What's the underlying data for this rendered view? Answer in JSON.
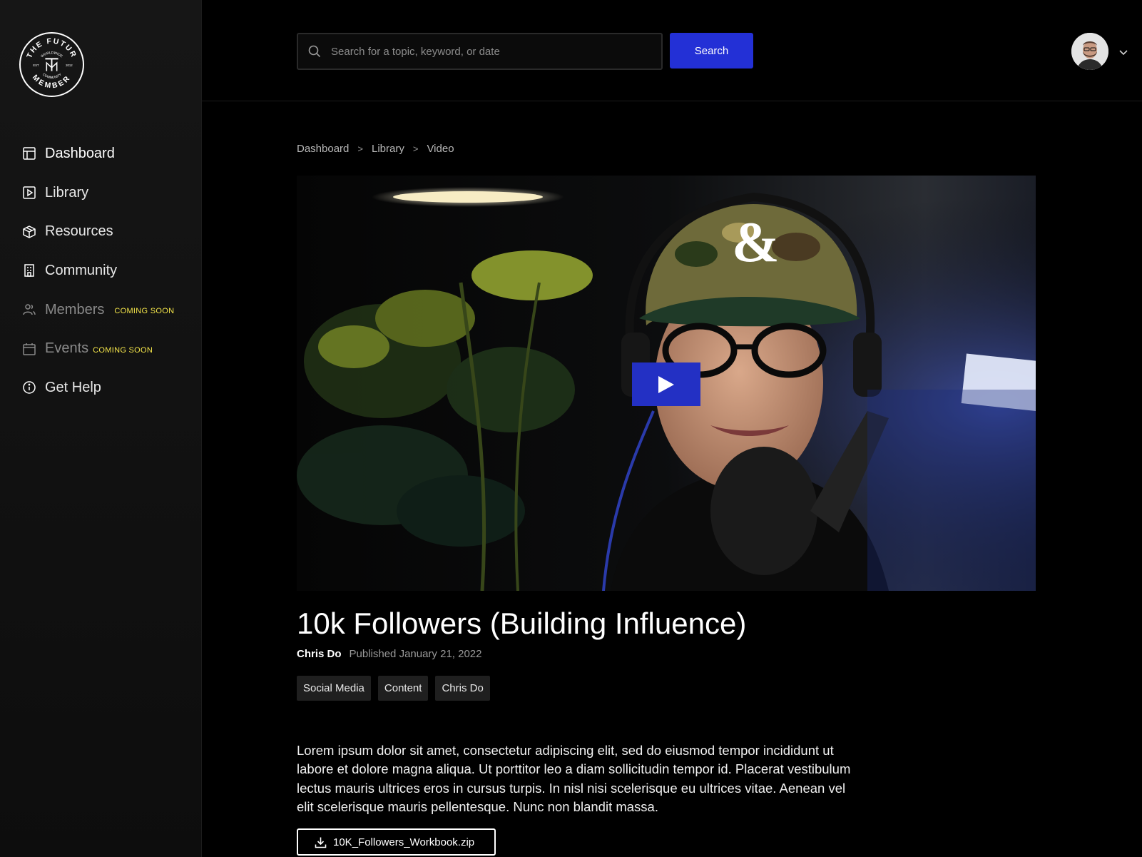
{
  "brand": {
    "logo_lines": [
      "THE FUTUR",
      "WORLDWIDE",
      "COMMUNITY",
      "MEMBER",
      "EST",
      "2012"
    ]
  },
  "sidebar": {
    "items": [
      {
        "label": "Dashboard",
        "icon": "dashboard-icon",
        "state": "active"
      },
      {
        "label": "Library",
        "icon": "play-square-icon",
        "state": "normal"
      },
      {
        "label": "Resources",
        "icon": "box-icon",
        "state": "normal"
      },
      {
        "label": "Community",
        "icon": "building-icon",
        "state": "normal"
      },
      {
        "label": "Members",
        "icon": "users-icon",
        "state": "disabled",
        "badge": "COMING SOON"
      },
      {
        "label": "Events",
        "icon": "calendar-icon",
        "state": "disabled",
        "badge": "COMING SOON"
      },
      {
        "label": "Get Help",
        "icon": "info-icon",
        "state": "normal"
      }
    ]
  },
  "header": {
    "search_placeholder": "Search for a topic, keyword, or date",
    "search_button": "Search"
  },
  "breadcrumb": {
    "items": [
      "Dashboard",
      "Library",
      "Video"
    ],
    "separator": ">"
  },
  "video": {
    "title": "10k Followers (Building Influence)",
    "author": "Chris Do",
    "published": "Published January 21, 2022",
    "tags": [
      "Social Media",
      "Content",
      "Chris Do"
    ],
    "description": "Lorem ipsum dolor sit amet, consectetur adipiscing elit, sed do eiusmod tempor incididunt ut labore et dolore magna aliqua. Ut porttitor leo a diam sollicitudin tempor id. Placerat vestibulum lectus mauris ultrices eros in cursus turpis. In nisl nisi scelerisque eu ultrices vitae. Aenean vel elit scelerisque mauris pellentesque. Nunc non blandit massa.",
    "download_label": "10K_Followers_Workbook.zip"
  },
  "colors": {
    "accent": "#2330d6",
    "coming_soon": "#f5e64a",
    "background": "#000000",
    "sidebar": "#141414"
  }
}
